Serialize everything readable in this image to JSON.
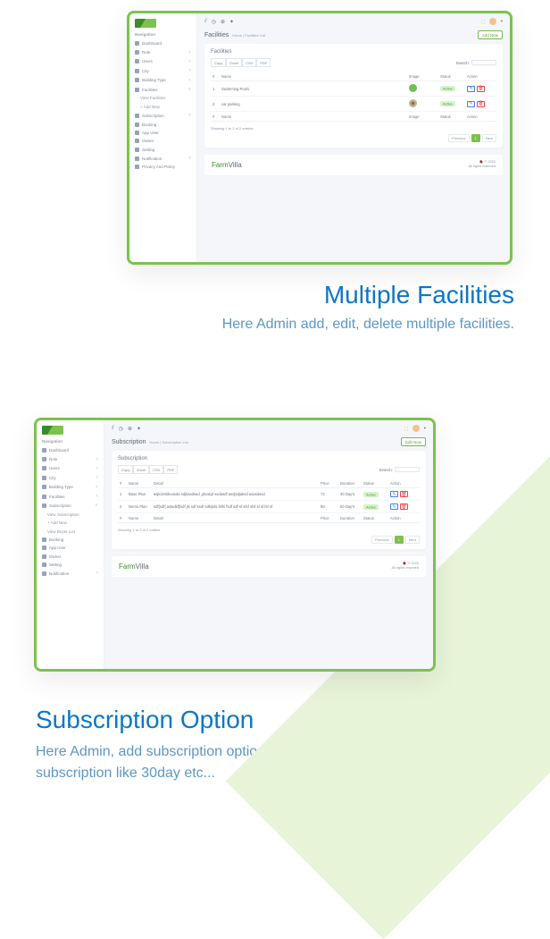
{
  "section1": {
    "title": "Multiple Facilities",
    "description": "Here Admin add, edit, delete multiple facilities."
  },
  "section2": {
    "title": "Subscription Option",
    "description": "Here Admin, add subscription option for owner, so user can buy subscription like 30day etc..."
  },
  "sidebar": {
    "nav_title": "Navigation",
    "items": [
      {
        "label": "Dashboard",
        "chev": ""
      },
      {
        "label": "Role",
        "chev": "<"
      },
      {
        "label": "Users",
        "chev": "<"
      },
      {
        "label": "City",
        "chev": "<"
      },
      {
        "label": "Building Type",
        "chev": "<"
      }
    ],
    "facilities_section": {
      "label": "Facilities",
      "sub_view": "View Facilities",
      "sub_add": "+  Add New"
    },
    "subscription_item": {
      "label": "Subscription",
      "chev": "<"
    },
    "subscription_section": {
      "label": "Subscription",
      "sub_view": "View Subscription",
      "sub_add": "+  Add New",
      "sub_buyer": "View Buyer List"
    },
    "facilities_item": {
      "label": "Facilities",
      "chev": "<"
    },
    "items2": [
      {
        "label": "Booking",
        "chev": ""
      },
      {
        "label": "App User",
        "chev": ""
      },
      {
        "label": "Owner",
        "chev": ""
      },
      {
        "label": "Setting",
        "chev": ""
      },
      {
        "label": "Notification",
        "chev": "<"
      },
      {
        "label": "Privacy And Policy",
        "chev": ""
      }
    ]
  },
  "topbar": {
    "icons": [
      "⊞",
      "⊙",
      "⊕",
      "✦"
    ]
  },
  "facilities_page": {
    "title": "Facilities",
    "crumb_home": "Home",
    "crumb_sep": "|",
    "crumb_current": "Facilities List",
    "add_new": "Add New",
    "card_title": "Facilities",
    "export": [
      "Copy",
      "Excel",
      "CSV",
      "PDF"
    ],
    "search_label": "Search:",
    "headers": {
      "num": "#",
      "name": "Name",
      "image": "Image",
      "status": "Status",
      "action": "Action"
    },
    "rows": [
      {
        "num": "1",
        "name": "Swimming Pool1",
        "status": "Active"
      },
      {
        "num": "2",
        "name": "car parking",
        "status": "Active"
      }
    ],
    "showing": "Showing 1 to 2 of 2 entries",
    "prev": "Previous",
    "one": "1",
    "next": "Next"
  },
  "subscription_page": {
    "title": "Subscription",
    "crumb_home": "Home",
    "crumb_sep": "|",
    "crumb_current": "Subscription List",
    "add_new": "Edit Now",
    "card_title": "Subscription",
    "export": [
      "Copy",
      "Excel",
      "CSV",
      "PDF"
    ],
    "search_label": "Search:",
    "headers": {
      "num": "#",
      "name": "Name",
      "detail": "Detail",
      "price": "Price",
      "duration": "Duration",
      "status": "Status",
      "action": "Action"
    },
    "rows": [
      {
        "num": "1",
        "name": "Base Plan",
        "detail": "asjkdvskbvasda sdjksadsad ,jdsakjd svdasdf asdjsdjaksd asasdasd",
        "price": "72",
        "duration": "30 Day's",
        "status": "Active"
      },
      {
        "num": "2",
        "name": "Demo Plan",
        "detail": "sdf[sdf] asladkf]lsdf jls sdf ksdf sdkljsfa fsfls fsdf sdf sf sfsf sfsf sl sf fsf sf",
        "price": "90",
        "duration": "50 Day's",
        "status": "Active"
      }
    ],
    "showing": "Showing 1 to 2 of 2 entries",
    "prev": "Previous",
    "one": "1",
    "next": "Next"
  },
  "footer": {
    "brand_f": "Farm",
    "brand_v": "Villa",
    "copy1": "© 2020",
    "copy2": "All rights reserved"
  }
}
